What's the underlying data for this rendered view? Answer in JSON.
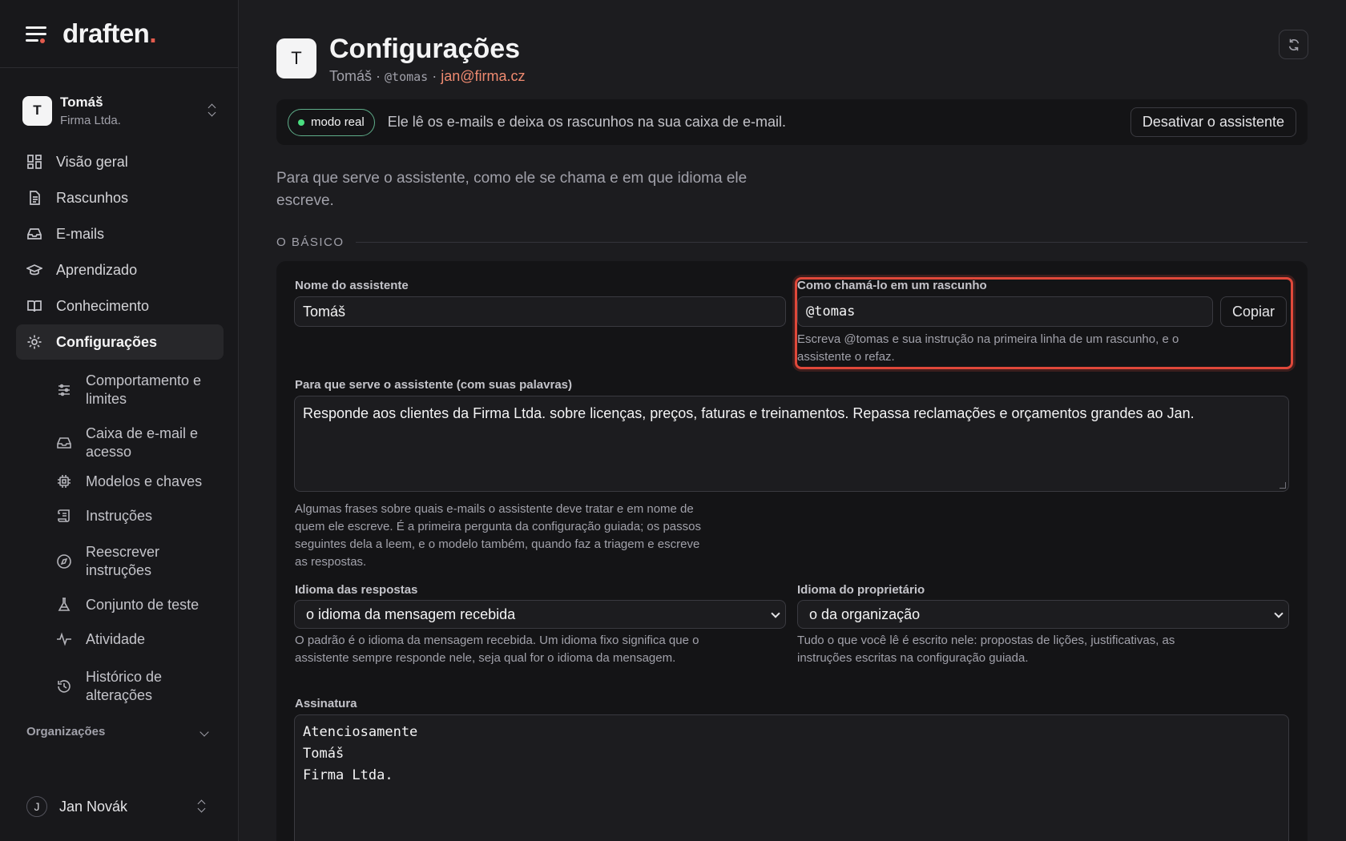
{
  "brand": {
    "name": "draften",
    "dot": "."
  },
  "workspace": {
    "initial": "T",
    "name": "Tomáš",
    "org": "Firma Ltda."
  },
  "nav": [
    {
      "label": "Visão geral",
      "icon": "dashboard-icon"
    },
    {
      "label": "Rascunhos",
      "icon": "document-icon"
    },
    {
      "label": "E-mails",
      "icon": "inbox-icon"
    },
    {
      "label": "Aprendizado",
      "icon": "graduation-cap-icon"
    },
    {
      "label": "Conhecimento",
      "icon": "book-icon"
    },
    {
      "label": "Configurações",
      "icon": "gear-icon",
      "active": true
    }
  ],
  "subnav": [
    {
      "label": "Comportamento e limites",
      "icon": "sliders-icon"
    },
    {
      "label": "Caixa de e-mail e acesso",
      "icon": "inbox-icon"
    },
    {
      "label": "Modelos e chaves",
      "icon": "chip-icon"
    },
    {
      "label": "Instruções",
      "icon": "scroll-icon"
    },
    {
      "label": "Reescrever instruções",
      "icon": "compass-icon"
    },
    {
      "label": "Conjunto de teste",
      "icon": "flask-icon"
    },
    {
      "label": "Atividade",
      "icon": "activity-icon"
    },
    {
      "label": "Histórico de alterações",
      "icon": "history-icon"
    }
  ],
  "organizations_label": "Organizações",
  "user": {
    "initial": "J",
    "name": "Jan Novák"
  },
  "page": {
    "avatar_initial": "T",
    "title": "Configurações",
    "meta_name": "Tomáš",
    "meta_sep1": " · ",
    "meta_handle": "@tomas",
    "meta_sep2": " · ",
    "meta_email": "jan@firma.cz"
  },
  "banner": {
    "badge": "modo real",
    "text": "Ele lê os e-mails e deixa os rascunhos na sua caixa de e-mail.",
    "button": "Desativar o assistente"
  },
  "intro": "Para que serve o assistente, como ele se chama e em que idioma ele escreve.",
  "section_title": "O BÁSICO",
  "form": {
    "name_label": "Nome do assistente",
    "name_value": "Tomáš",
    "handle_label": "Como chamá-lo em um rascunho",
    "handle_value": "@tomas",
    "copy_button": "Copiar",
    "handle_help": "Escreva @tomas e sua instrução na primeira linha de um rascunho, e o assistente o refaz.",
    "purpose_label": "Para que serve o assistente (com suas palavras)",
    "purpose_value": "Responde aos clientes da Firma Ltda. sobre licenças, preços, faturas e treinamentos. Repassa reclamações e orçamentos grandes ao Jan.",
    "purpose_help": "Algumas frases sobre quais e-mails o assistente deve tratar e em nome de quem ele escreve. É a primeira pergunta da configuração guiada; os passos seguintes dela a leem, e o modelo também, quando faz a triagem e escreve as respostas.",
    "reply_lang_label": "Idioma das respostas",
    "reply_lang_value": "o idioma da mensagem recebida",
    "reply_lang_help": "O padrão é o idioma da mensagem recebida. Um idioma fixo significa que o assistente sempre responde nele, seja qual for o idioma da mensagem.",
    "owner_lang_label": "Idioma do proprietário",
    "owner_lang_value": "o da organização",
    "owner_lang_help": "Tudo o que você lê é escrito nele: propostas de lições, justificativas, as instruções escritas na configuração guiada.",
    "signature_label": "Assinatura",
    "signature_lines": [
      "Atenciosamente",
      "Tomáš",
      "Firma Ltda."
    ]
  },
  "colors": {
    "accent": "#e25b4d",
    "email": "#ef8a70",
    "live": "#4ade80",
    "highlight": "#e0483a"
  }
}
